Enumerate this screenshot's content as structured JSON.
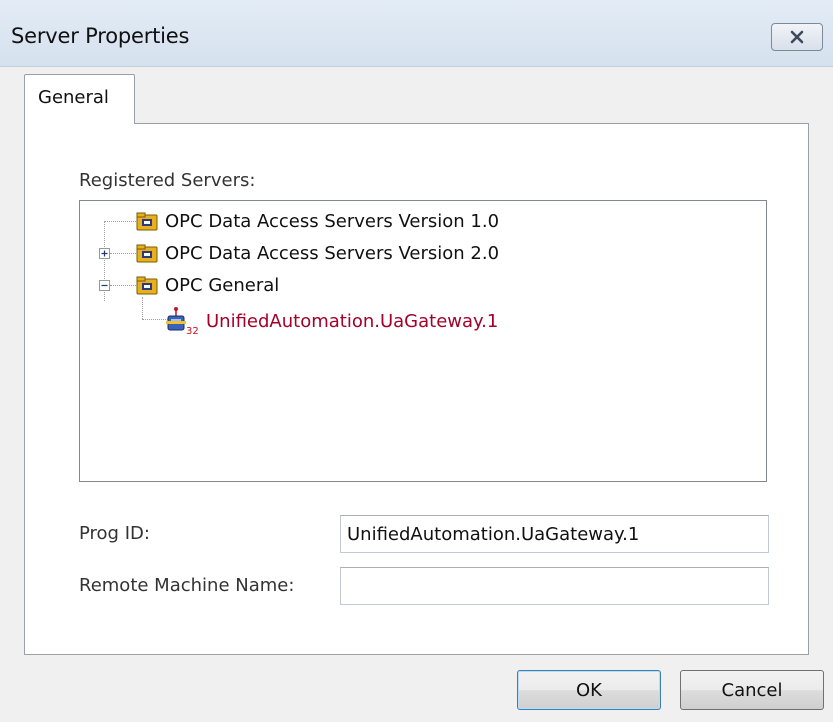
{
  "window": {
    "title": "Server Properties",
    "close_icon": "close-x-icon"
  },
  "tabs": [
    {
      "label": "General",
      "active": true
    }
  ],
  "registered_servers": {
    "label": "Registered Servers:",
    "nodes": [
      {
        "text": "OPC Data Access Servers Version 1.0",
        "icon": "folder-icon",
        "expander": "none"
      },
      {
        "text": "OPC Data Access Servers Version 2.0",
        "icon": "folder-icon",
        "expander": "collapsed"
      },
      {
        "text": "OPC General",
        "icon": "folder-icon",
        "expander": "expanded"
      },
      {
        "text": "UnifiedAutomation.UaGateway.1",
        "icon": "server-icon",
        "expander": "none",
        "icon_badge": "32"
      }
    ]
  },
  "prog_id": {
    "label": "Prog ID:",
    "value": "UnifiedAutomation.UaGateway.1"
  },
  "remote_machine": {
    "label": "Remote Machine Name:",
    "value": ""
  },
  "buttons": {
    "ok": "OK",
    "cancel": "Cancel"
  },
  "colors": {
    "selected_server_text": "#a4002a",
    "folder_fill": "#e8b01e"
  }
}
